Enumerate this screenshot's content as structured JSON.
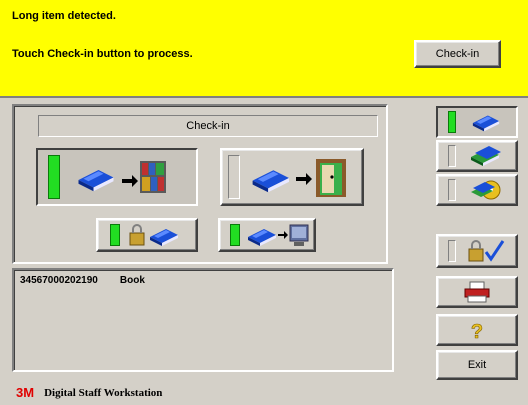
{
  "message": {
    "line1": "Long item detected.",
    "line2": "Touch Check-in button to process.",
    "checkin_button_label": "Check-in",
    "background_color": "#ffff00"
  },
  "mode_panel": {
    "title": "Check-in",
    "buttons": [
      {
        "name": "checkin-book-to-shelf",
        "icon": "book-to-shelf-icon",
        "active": true
      },
      {
        "name": "checkin-book-to-door",
        "icon": "book-to-door-icon",
        "active": false
      },
      {
        "name": "security-lock-book",
        "icon": "lock-book-icon",
        "active": true
      },
      {
        "name": "book-to-terminal",
        "icon": "book-to-terminal-icon",
        "active": true
      }
    ]
  },
  "item_list": {
    "rows": [
      {
        "id": "34567000202190",
        "type": "Book"
      }
    ]
  },
  "side_buttons": [
    {
      "name": "single-book",
      "icon": "blue-book-icon",
      "active": true
    },
    {
      "name": "green-books",
      "icon": "green-books-icon",
      "active": false
    },
    {
      "name": "mixed-media",
      "icon": "mixed-media-icon",
      "active": false
    },
    {
      "name": "lock-check",
      "icon": "lock-check-icon",
      "active": false
    },
    {
      "name": "receipt-printer",
      "icon": "printer-icon"
    },
    {
      "name": "help",
      "icon": "question-icon"
    }
  ],
  "exit_label": "Exit",
  "footer": {
    "brand": "3M",
    "product": "Digital Staff Workstation"
  },
  "colors": {
    "indicator_on": "#22dd22",
    "brand_red": "#e00000"
  }
}
